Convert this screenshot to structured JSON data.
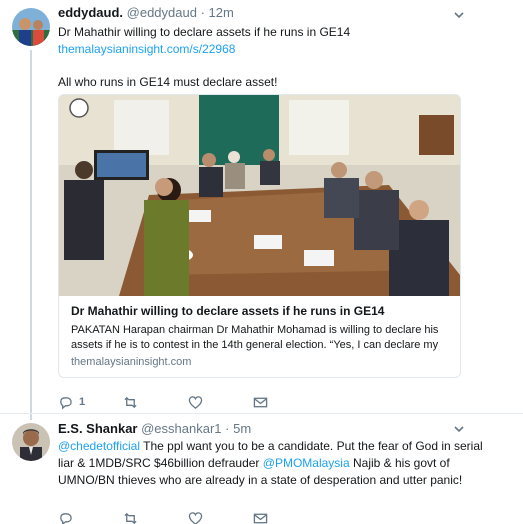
{
  "tweet1": {
    "name": "eddydaud.",
    "handle": "@eddydaud",
    "separator": "·",
    "time": "12m",
    "line1": "Dr Mahathir willing to declare assets if he runs in GE14",
    "link": "themalaysianinsight.com/s/22968",
    "line2": "All who runs in GE14 must declare asset!",
    "card": {
      "title": "Dr Mahathir willing to declare assets if he runs in GE14",
      "description": "PAKATAN Harapan chairman Dr Mahathir Mohamad is willing to declare his assets if he is to contest in the 14th general election.  “Yes, I can declare my",
      "domain": "themalaysianinsight.com"
    },
    "actions": {
      "reply_count": "1"
    }
  },
  "tweet2": {
    "name": "E.S. Shankar",
    "handle": "@esshankar1",
    "separator": "·",
    "time": "5m",
    "mention1": "@chedetofficial",
    "text1": " The ppl want you to be a candidate. Put the fear of God in serial liar & 1MDB/SRC $46billion defrauder ",
    "mention2": "@PMOMalaysia",
    "text2": " Najib & his govt of UMNO/BN thieves who are already in a state of desperation and utter panic!"
  },
  "colors": {
    "link": "#1da1f2",
    "secondary_text": "#657786",
    "divider": "#e6ecf0"
  },
  "icons": [
    "reply-icon",
    "retweet-icon",
    "like-icon",
    "direct-message-icon",
    "chevron-down-icon"
  ]
}
